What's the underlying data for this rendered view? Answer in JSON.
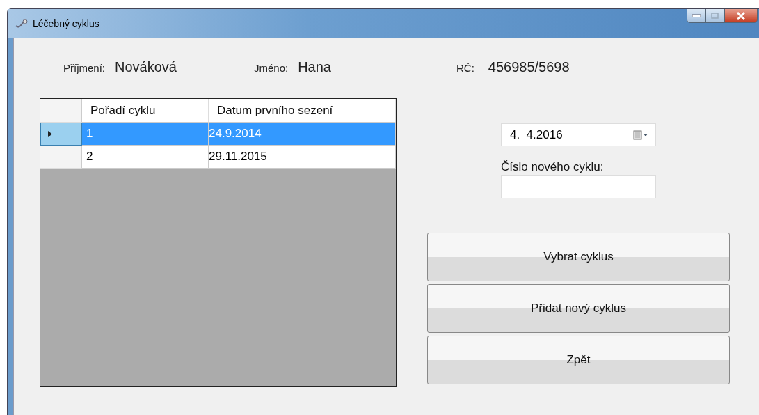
{
  "window": {
    "title": "Léčebný cyklus"
  },
  "patient": [
    {
      "label": "Příjmení:",
      "value": "Nováková"
    },
    {
      "label": "Jméno:",
      "value": "Hana"
    },
    {
      "label": "RČ:",
      "value": "456985/5698"
    }
  ],
  "table": {
    "columns": [
      "Pořadí cyklu",
      "Datum prvního sezení"
    ],
    "rows": [
      {
        "cells": [
          "1",
          "24.9.2014"
        ],
        "selected": true
      },
      {
        "cells": [
          "2",
          "29.11.2015"
        ],
        "selected": false
      }
    ]
  },
  "date_picker": {
    "value": "4.  4.2016"
  },
  "new_cycle": {
    "label": "Číslo nového cyklu:"
  },
  "buttons": [
    "Vybrat cyklus",
    "Přidat nový cyklus",
    "Zpět"
  ]
}
